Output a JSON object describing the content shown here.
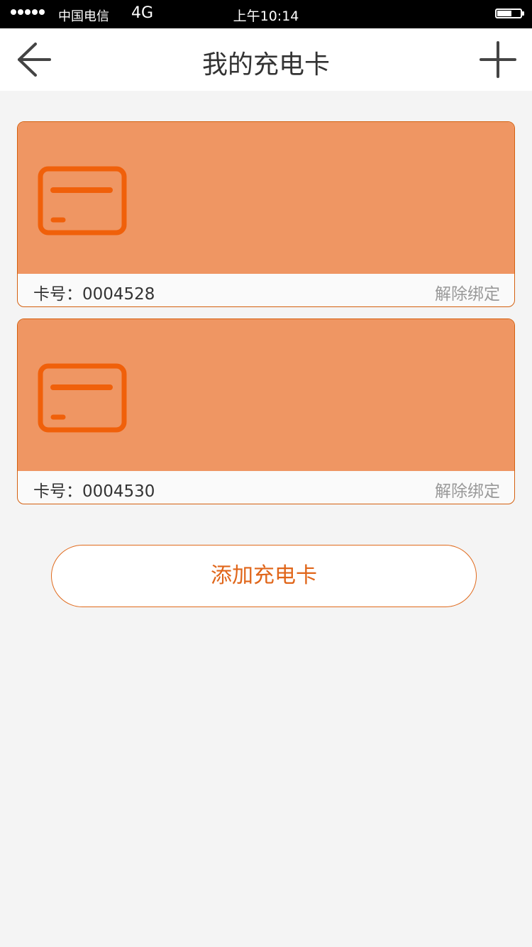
{
  "status_bar": {
    "carrier": "中国电信",
    "network": "4G",
    "time": "上午10:14"
  },
  "header": {
    "title": "我的充电卡",
    "back_icon": "arrow-left-icon",
    "add_icon": "plus-icon"
  },
  "cards": [
    {
      "number_label": "卡号：0004528",
      "unbind_label": "解除绑定",
      "icon": "card-icon"
    },
    {
      "number_label": "卡号：0004530",
      "unbind_label": "解除绑定",
      "icon": "card-icon"
    }
  ],
  "add_card_label": "添加充电卡",
  "colors": {
    "card_bg": "#ef9663",
    "card_icon": "#f0600a",
    "accent": "#e0661a",
    "page_bg": "#f4f4f4"
  }
}
